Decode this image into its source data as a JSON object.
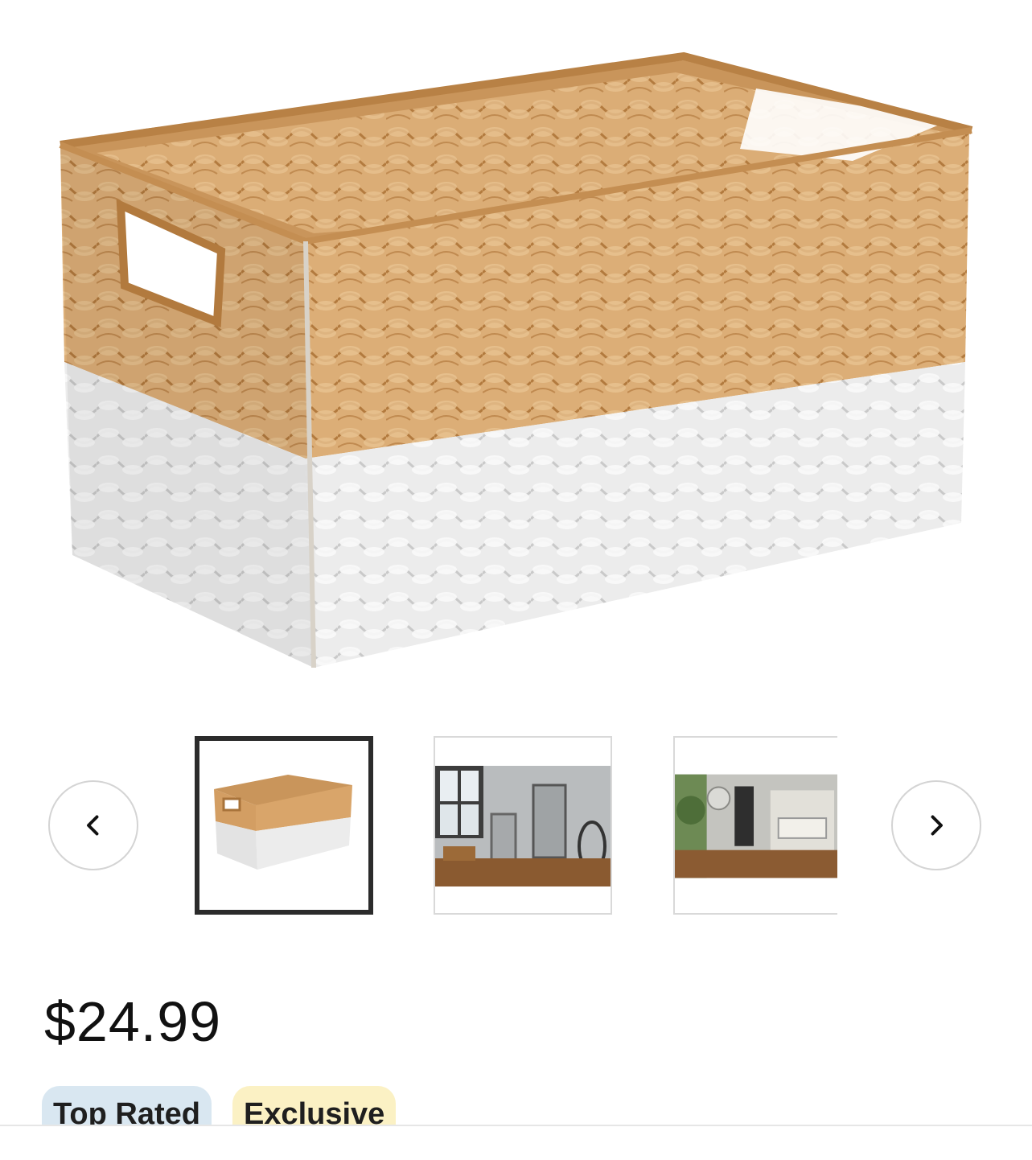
{
  "product": {
    "main_image_alt": "Two-tone water hyacinth storage basket with handles",
    "price": "$24.99",
    "badges": {
      "top_rated": "Top Rated",
      "exclusive": "Exclusive"
    }
  },
  "carousel": {
    "prev_icon": "chevron-left-icon",
    "next_icon": "chevron-right-icon",
    "thumbnails": [
      {
        "description": "basket product shot",
        "selected": true
      },
      {
        "description": "room with mirrors and basket",
        "selected": false
      },
      {
        "description": "entryway room scene",
        "selected": false
      }
    ]
  },
  "colors": {
    "wicker": "#d9a56a",
    "wicker_dark": "#b27a3e",
    "white_weave": "#efefef",
    "badge_blue": "#d9e7f1",
    "badge_yellow": "#fbf1c4",
    "thumb_selected_border": "#2b2b2b"
  }
}
